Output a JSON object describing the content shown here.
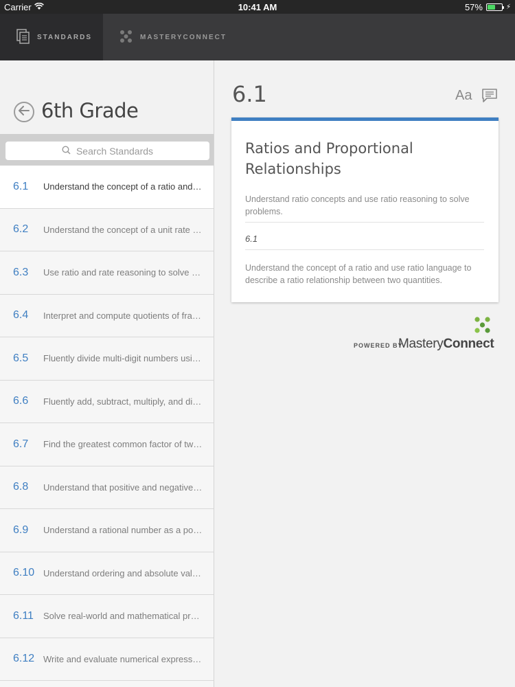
{
  "status_bar": {
    "carrier": "Carrier",
    "time": "10:41 AM",
    "battery": "57%",
    "battery_level": 0.57
  },
  "tabs": [
    {
      "label": "STANDARDS",
      "icon": "document-stack-icon",
      "active": true
    },
    {
      "label": "MASTERYCONNECT",
      "icon": "masteryconnect-logo-icon",
      "active": false
    }
  ],
  "sidebar": {
    "title": "6th Grade",
    "search_placeholder": "Search Standards",
    "items": [
      {
        "num": "6.1",
        "text": "Understand the concept of a ratio and use ratio language to describe a ratio relationship"
      },
      {
        "num": "6.2",
        "text": "Understand the concept of a unit rate associated with a ratio"
      },
      {
        "num": "6.3",
        "text": "Use ratio and rate reasoning to solve real-world problems"
      },
      {
        "num": "6.4",
        "text": "Interpret and compute quotients of fractions"
      },
      {
        "num": "6.5",
        "text": "Fluently divide multi-digit numbers using the standard algorithm"
      },
      {
        "num": "6.6",
        "text": "Fluently add, subtract, multiply, and divide multi-digit decimals"
      },
      {
        "num": "6.7",
        "text": "Find the greatest common factor of two whole numbers"
      },
      {
        "num": "6.8",
        "text": "Understand that positive and negative numbers are used together"
      },
      {
        "num": "6.9",
        "text": "Understand a rational number as a point on the number line"
      },
      {
        "num": "6.10",
        "text": "Understand ordering and absolute value of rational numbers"
      },
      {
        "num": "6.11",
        "text": "Solve real-world and mathematical problems by graphing points"
      },
      {
        "num": "6.12",
        "text": "Write and evaluate numerical expressions involving exponents"
      }
    ]
  },
  "detail": {
    "code": "6.1",
    "font_button": "Aa",
    "card": {
      "title": "Ratios and Proportional Relationships",
      "description": "Understand ratio concepts and use ratio reasoning to solve problems.",
      "code": "6.1",
      "detail": "Understand the concept of a ratio and use ratio language to describe a ratio relationship between two quantities."
    },
    "powered_by": "POWERED BY",
    "brand_light": "Mastery",
    "brand_bold": "Connect"
  },
  "colors": {
    "accent": "#3f7fc2",
    "brand_green": "#7cb342",
    "topbar": "#3a3a3c"
  }
}
